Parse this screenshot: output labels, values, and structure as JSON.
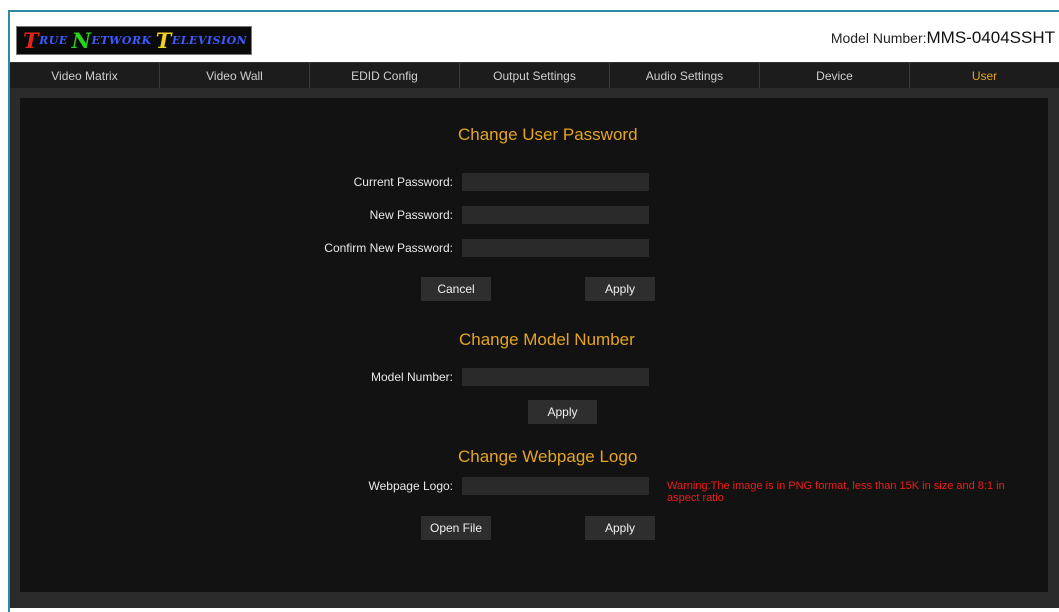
{
  "header": {
    "logo": {
      "t1": "T",
      "w1": "rue",
      "t2": "N",
      "w2": "etwork",
      "t3": "T",
      "w3": "elevision"
    },
    "model_label": "Model Number:",
    "model_value": "MMS-0404SSHT"
  },
  "nav": {
    "tabs": [
      "Video Matrix",
      "Video Wall",
      "EDID Config",
      "Output Settings",
      "Audio Settings",
      "Device",
      "User"
    ],
    "active": "User"
  },
  "password_section": {
    "title": "Change User Password",
    "current_label": "Current Password:",
    "new_label": "New Password:",
    "confirm_label": "Confirm New Password:",
    "current_value": "",
    "new_value": "",
    "confirm_value": "",
    "cancel_label": "Cancel",
    "apply_label": "Apply"
  },
  "model_section": {
    "title": "Change Model Number",
    "model_label": "Model Number:",
    "model_value": "",
    "apply_label": "Apply"
  },
  "logo_section": {
    "title": "Change Webpage Logo",
    "logo_label": "Webpage Logo:",
    "logo_value": "",
    "warning": "Warning:The image is in PNG format, less than 15K in size and 8:1 in aspect ratio",
    "open_label": "Open File",
    "apply_label": "Apply"
  },
  "colors": {
    "accent": "#e5a521",
    "warning": "#ee1c1c",
    "nav_bg": "#1c1c1c",
    "panel_bg": "#121212"
  }
}
